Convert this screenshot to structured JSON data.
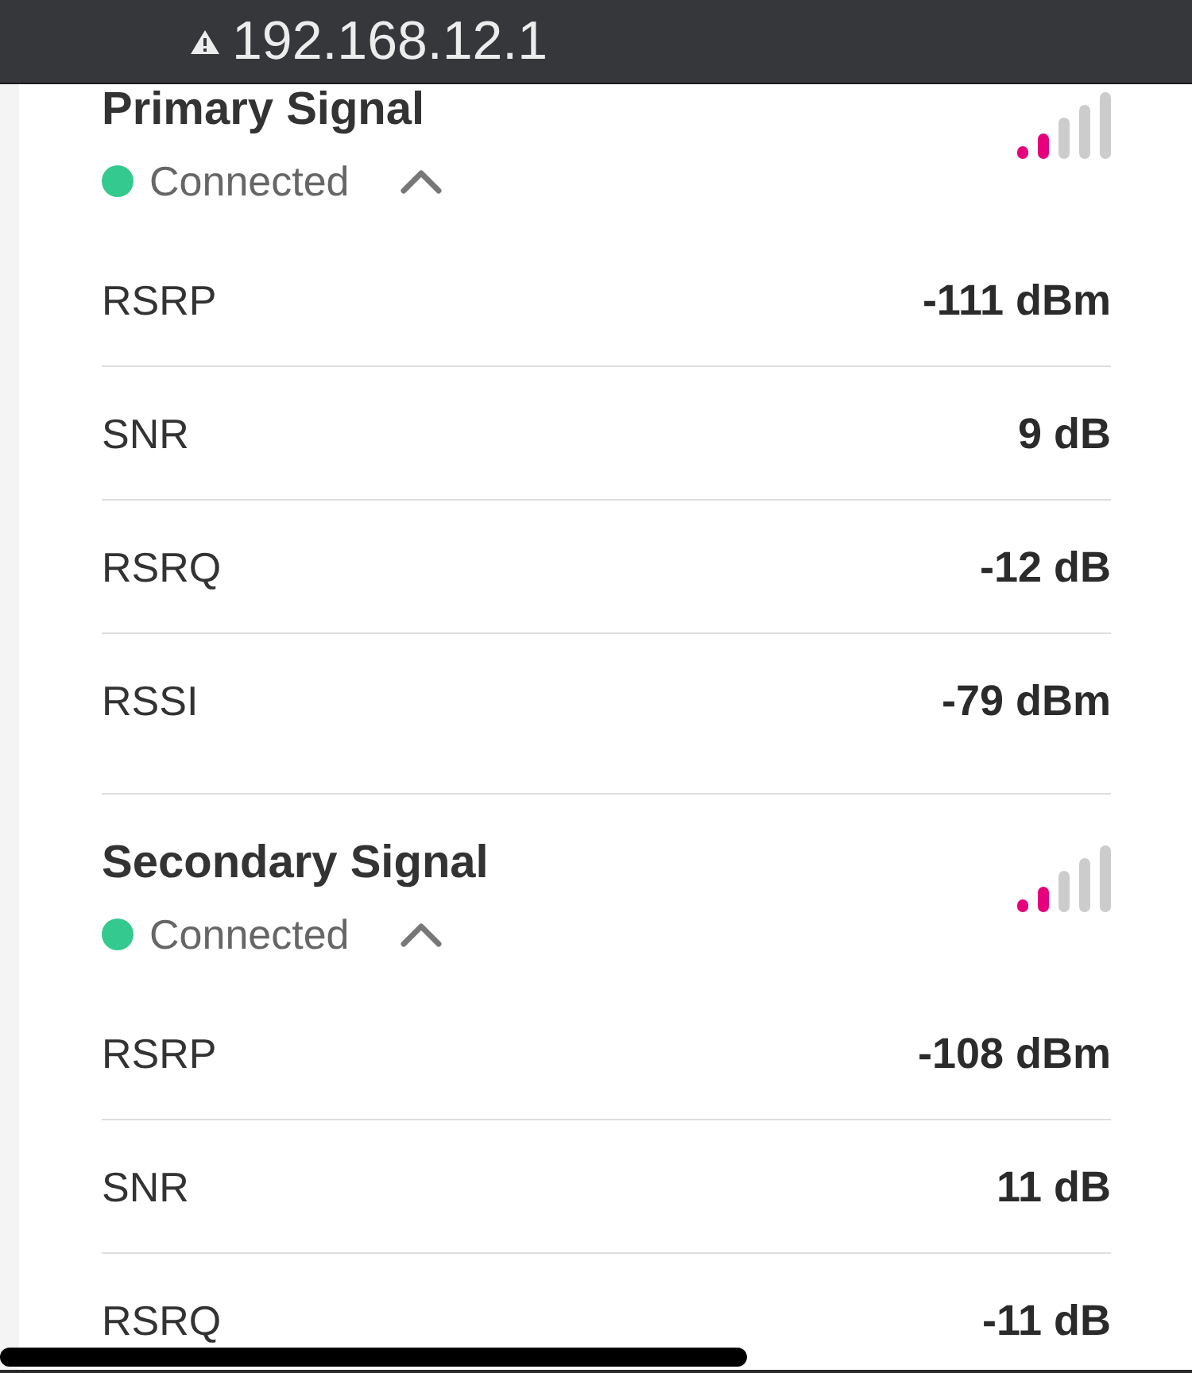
{
  "address_bar": {
    "url": "192.168.12.1"
  },
  "sections": [
    {
      "title": "Primary Signal",
      "status": "Connected",
      "expanded": true,
      "rows": [
        {
          "label": "RSRP",
          "value": "-111 dBm"
        },
        {
          "label": "SNR",
          "value": "9 dB"
        },
        {
          "label": "RSRQ",
          "value": "-12 dB"
        },
        {
          "label": "RSSI",
          "value": "-79 dBm"
        }
      ]
    },
    {
      "title": "Secondary Signal",
      "status": "Connected",
      "expanded": true,
      "rows": [
        {
          "label": "RSRP",
          "value": "-108 dBm"
        },
        {
          "label": "SNR",
          "value": "11 dB"
        },
        {
          "label": "RSRQ",
          "value": "-11 dB"
        }
      ]
    }
  ]
}
